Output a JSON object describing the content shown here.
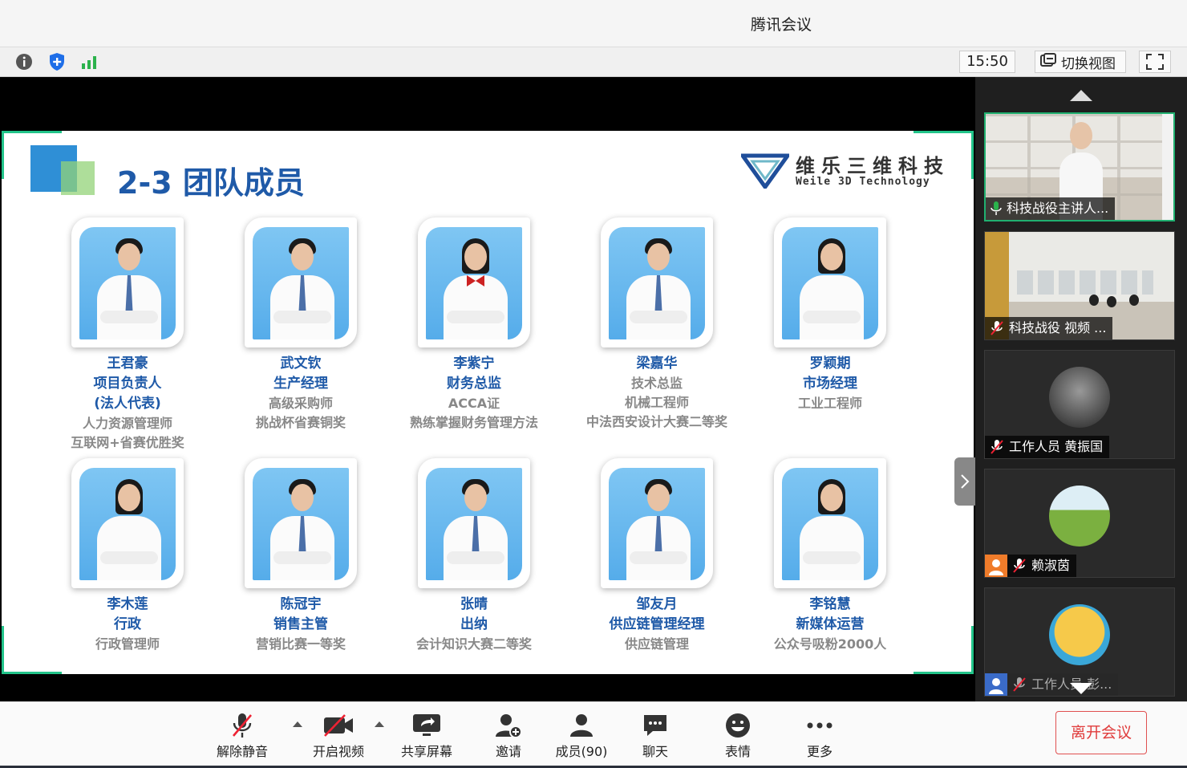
{
  "window": {
    "title": "腾讯会议"
  },
  "infobar": {
    "time": "15:50",
    "switch_view_label": "切换视图"
  },
  "slide": {
    "title": "2-3 团队成员",
    "logo_cn": "维乐三维科技",
    "logo_en": "Weile 3D Technology",
    "members": [
      {
        "name": "王君豪",
        "roles": [
          "项目负责人",
          "(法人代表)"
        ],
        "extras": [
          "人力资源管理师",
          "互联网+省赛优胜奖"
        ]
      },
      {
        "name": "武文钦",
        "roles": [
          "生产经理"
        ],
        "extras": [
          "高级采购师",
          "挑战杯省赛铜奖"
        ]
      },
      {
        "name": "李紫宁",
        "roles": [
          "财务总监"
        ],
        "extras": [
          "ACCA证",
          "熟练掌握财务管理方法"
        ]
      },
      {
        "name": "梁嘉华",
        "roles": [],
        "extras": [
          "技术总监",
          "机械工程师",
          "中法西安设计大赛二等奖"
        ]
      },
      {
        "name": "罗颖期",
        "roles": [
          "市场经理"
        ],
        "extras": [
          "工业工程师"
        ]
      },
      {
        "name": "李木莲",
        "roles": [
          "行政"
        ],
        "extras": [
          "行政管理师"
        ]
      },
      {
        "name": "陈冠宇",
        "roles": [
          "销售主管"
        ],
        "extras": [
          "营销比赛一等奖"
        ]
      },
      {
        "name": "张晴",
        "roles": [
          "出纳"
        ],
        "extras": [
          "会计知识大赛二等奖"
        ]
      },
      {
        "name": "邹友月",
        "roles": [
          "供应链管理经理"
        ],
        "extras": [
          "供应链管理"
        ]
      },
      {
        "name": "李铭慧",
        "roles": [
          "新媒体运营"
        ],
        "extras": [
          "公众号吸粉2000人"
        ]
      }
    ]
  },
  "participants": [
    {
      "label": "科技战役主讲人...",
      "muted": false
    },
    {
      "label": "科技战役 视频 ...",
      "muted": true
    },
    {
      "label": "工作人员 黄振国",
      "muted": true
    },
    {
      "label": "赖淑茵",
      "muted": true
    },
    {
      "label": "工作人员 彭...",
      "muted": true
    }
  ],
  "toolbar": {
    "unmute": "解除静音",
    "video": "开启视频",
    "share": "共享屏幕",
    "invite": "邀请",
    "members": "成员(90)",
    "chat": "聊天",
    "emoji": "表情",
    "more": "更多",
    "leave": "离开会议"
  },
  "colors": {
    "accent_green": "#22c48a",
    "title_blue": "#1f5aa8",
    "leave_red": "#e03c3c"
  }
}
